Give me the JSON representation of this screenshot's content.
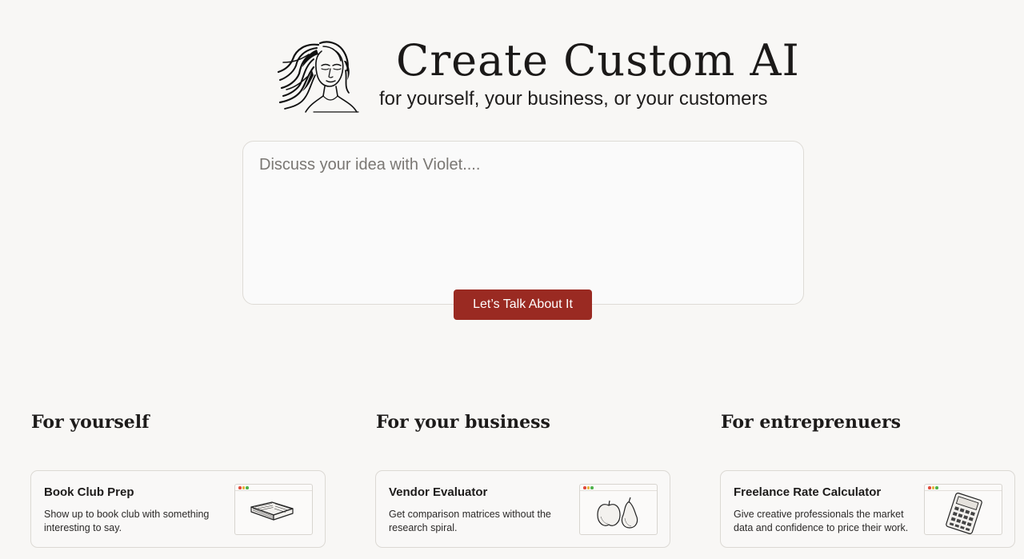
{
  "hero": {
    "title": "Create Custom AI",
    "subtitle": "for yourself, your business, or your customers",
    "logo_icon": "woman-face-sketch-icon"
  },
  "prompt": {
    "placeholder": "Discuss your idea with Violet....",
    "value": "",
    "button_label": "Let’s Talk About It"
  },
  "colors": {
    "background": "#f8f7f5",
    "accent": "#9a2a22",
    "card_border": "#dcd9d4"
  },
  "sections": [
    {
      "heading": "For yourself",
      "card": {
        "title": "Book Club Prep",
        "description": "Show up to book club with something interesting to say.",
        "icon": "open-book-icon"
      }
    },
    {
      "heading": "For your business",
      "card": {
        "title": "Vendor Evaluator",
        "description": "Get comparison matrices without the research spiral.",
        "icon": "apple-pear-icon"
      }
    },
    {
      "heading": "For entreprenuers",
      "card": {
        "title": "Freelance Rate Calculator",
        "description": "Give creative professionals the market data and confidence to price their work.",
        "icon": "calculator-icon"
      }
    }
  ]
}
